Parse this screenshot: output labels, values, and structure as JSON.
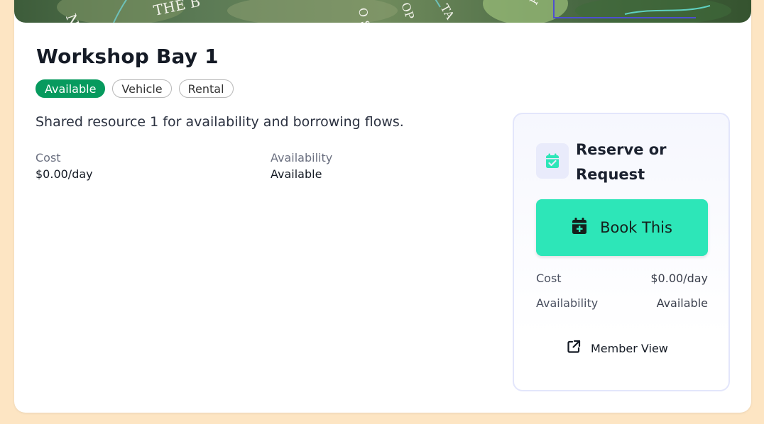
{
  "hero": {
    "map_text": [
      "N ZO",
      "THE B",
      "O SH",
      "OP",
      "TA",
      "RD"
    ]
  },
  "resource": {
    "title": "Workshop Bay 1",
    "badges": {
      "status": "Available",
      "type": "Vehicle",
      "category": "Rental"
    },
    "description": "Shared resource 1 for availability and borrowing flows.",
    "fields": {
      "cost_label": "Cost",
      "cost_value": "$0.00/day",
      "availability_label": "Availability",
      "availability_value": "Available"
    }
  },
  "panel": {
    "title": "Reserve or Request",
    "book_label": "Book This",
    "cost_label": "Cost",
    "cost_value": "$0.00/day",
    "availability_label": "Availability",
    "availability_value": "Available",
    "member_link_label": "Member View"
  },
  "icons": {
    "calendar": "calendar-check-icon",
    "book": "calendar-plus-icon",
    "external": "external-link-icon"
  },
  "colors": {
    "page_background": "#fde5c3",
    "status_badge": "#079a5e",
    "book_button": "#2de6b8",
    "panel_border": "#e3e6fb",
    "calendar_icon": "#2de6b8"
  }
}
